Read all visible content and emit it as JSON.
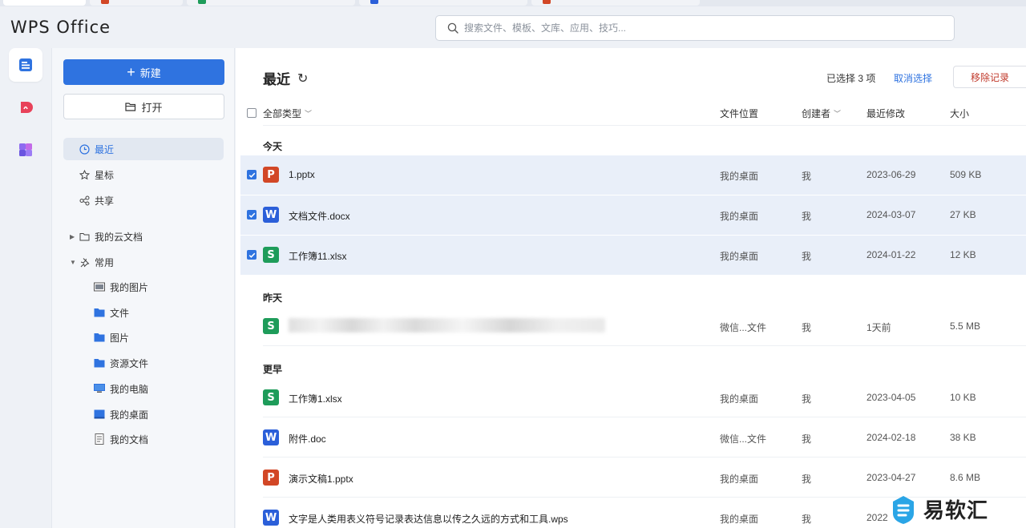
{
  "app": {
    "logo": "WPS Office"
  },
  "search": {
    "placeholder": "搜索文件、模板、文库、应用、技巧..."
  },
  "sidebar": {
    "new_label": "新建",
    "open_label": "打开",
    "nav": [
      {
        "label": "最近",
        "active": true
      },
      {
        "label": "星标"
      },
      {
        "label": "共享"
      }
    ],
    "tree": [
      {
        "label": "我的云文档"
      },
      {
        "label": "常用"
      }
    ],
    "sub": [
      {
        "label": "我的图片"
      },
      {
        "label": "文件"
      },
      {
        "label": "图片"
      },
      {
        "label": "资源文件"
      },
      {
        "label": "我的电脑"
      },
      {
        "label": "我的桌面"
      },
      {
        "label": "我的文档"
      }
    ]
  },
  "main": {
    "title": "最近",
    "selection": "已选择 3 项",
    "cancel_selection": "取消选择",
    "remove_records": "移除记录",
    "columns": {
      "type": "全部类型",
      "location": "文件位置",
      "creator": "创建者",
      "modified": "最近修改",
      "size": "大小"
    },
    "sections": {
      "today": "今天",
      "yesterday": "昨天",
      "earlier": "更早"
    },
    "files": [
      {
        "icon": "P",
        "color": "#d24726",
        "name": "1.pptx",
        "location": "我的桌面",
        "creator": "我",
        "modified": "2023-06-29",
        "size": "509 KB",
        "selected": true
      },
      {
        "icon": "W",
        "color": "#2b5fd9",
        "name": "文档文件.docx",
        "location": "我的桌面",
        "creator": "我",
        "modified": "2024-03-07",
        "size": "27 KB",
        "selected": true
      },
      {
        "icon": "S",
        "color": "#1e9c5a",
        "name": "工作簿11.xlsx",
        "location": "我的桌面",
        "creator": "我",
        "modified": "2024-01-22",
        "size": "12 KB",
        "selected": true
      },
      {
        "icon": "S",
        "color": "#1e9c5a",
        "name": "",
        "location": "微信...文件",
        "creator": "我",
        "modified": "1天前",
        "size": "5.5 MB",
        "selected": false
      },
      {
        "icon": "S",
        "color": "#1e9c5a",
        "name": "工作簿1.xlsx",
        "location": "我的桌面",
        "creator": "我",
        "modified": "2023-04-05",
        "size": "10 KB",
        "selected": false
      },
      {
        "icon": "W",
        "color": "#2b5fd9",
        "name": "附件.doc",
        "location": "微信...文件",
        "creator": "我",
        "modified": "2024-02-18",
        "size": "38 KB",
        "selected": false
      },
      {
        "icon": "P",
        "color": "#d24726",
        "name": "演示文稿1.pptx",
        "location": "我的桌面",
        "creator": "我",
        "modified": "2023-04-27",
        "size": "8.6 MB",
        "selected": false
      },
      {
        "icon": "W",
        "color": "#2b5fd9",
        "name": "文字是人类用表义符号记录表达信息以传之久远的方式和工具.wps",
        "location": "我的桌面",
        "creator": "我",
        "modified": "2022",
        "size": "",
        "selected": false
      }
    ]
  },
  "watermark": {
    "text": "易软汇"
  }
}
